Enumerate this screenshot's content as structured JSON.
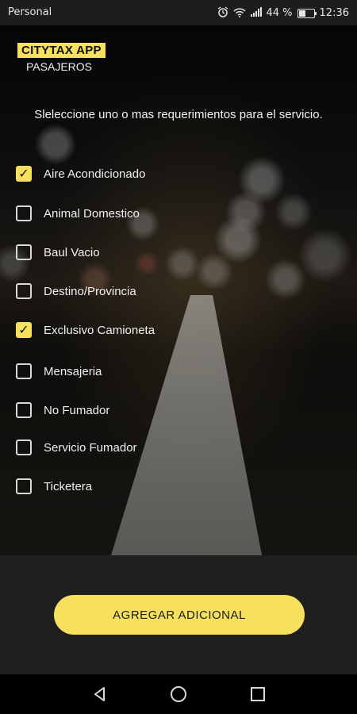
{
  "status_bar": {
    "carrier": "Personal",
    "battery": "44 %",
    "time": "12:36"
  },
  "header": {
    "app_name": "CITYTAX APP",
    "subtitle": "PASAJEROS"
  },
  "instruction": "Sleleccione uno o mas requerimientos para el servicio.",
  "options": [
    {
      "label": "Aire Acondicionado",
      "checked": true
    },
    {
      "label": "Animal Domestico",
      "checked": false
    },
    {
      "label": "Baul Vacio",
      "checked": false
    },
    {
      "label": "Destino/Provincia",
      "checked": false
    },
    {
      "label": "Exclusivo Camioneta",
      "checked": true
    },
    {
      "label": "Mensajeria",
      "checked": false
    },
    {
      "label": "No Fumador",
      "checked": false
    },
    {
      "label": "Servicio Fumador",
      "checked": false
    },
    {
      "label": "Ticketera",
      "checked": false
    }
  ],
  "add_button": "AGREGAR ADICIONAL",
  "colors": {
    "accent": "#f6e05e",
    "panel": "#1f1f1f"
  },
  "icons": {
    "alarm": "alarm-icon",
    "wifi": "wifi-icon",
    "signal": "signal-icon",
    "battery": "battery-icon",
    "back": "back-icon",
    "home": "home-icon",
    "recents": "recents-icon"
  }
}
